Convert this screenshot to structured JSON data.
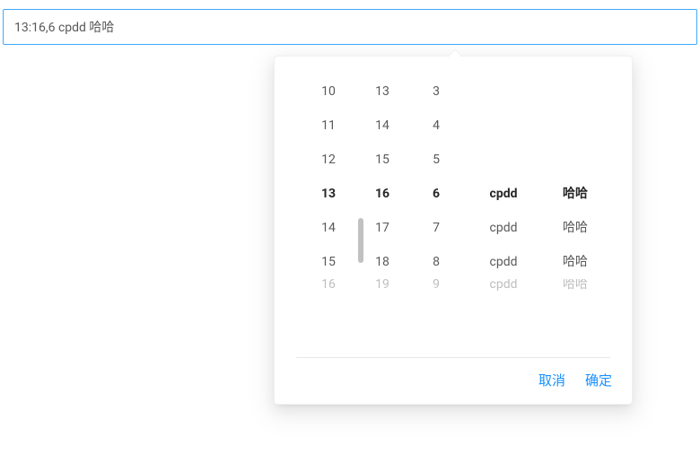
{
  "input": {
    "value": "13:16,6 cpdd 哈哈"
  },
  "picker": {
    "columns": {
      "col1": {
        "items": [
          "10",
          "11",
          "12",
          "13",
          "14",
          "15"
        ],
        "selectedIndex": 3,
        "partial": "16"
      },
      "col2": {
        "items": [
          "13",
          "14",
          "15",
          "16",
          "17",
          "18"
        ],
        "selectedIndex": 3,
        "partial": "19"
      },
      "col3": {
        "items": [
          "3",
          "4",
          "5",
          "6",
          "7",
          "8"
        ],
        "selectedIndex": 3,
        "partial": "9"
      },
      "col4": {
        "items": [
          "",
          "",
          "",
          "cpdd",
          "cpdd",
          "cpdd"
        ],
        "selectedIndex": 3,
        "partial": "cpdd"
      },
      "col5": {
        "items": [
          "",
          "",
          "",
          "哈哈",
          "哈哈",
          "哈哈"
        ],
        "selectedIndex": 3,
        "partial": "哈哈"
      }
    },
    "footer": {
      "cancel": "取消",
      "confirm": "确定"
    }
  }
}
